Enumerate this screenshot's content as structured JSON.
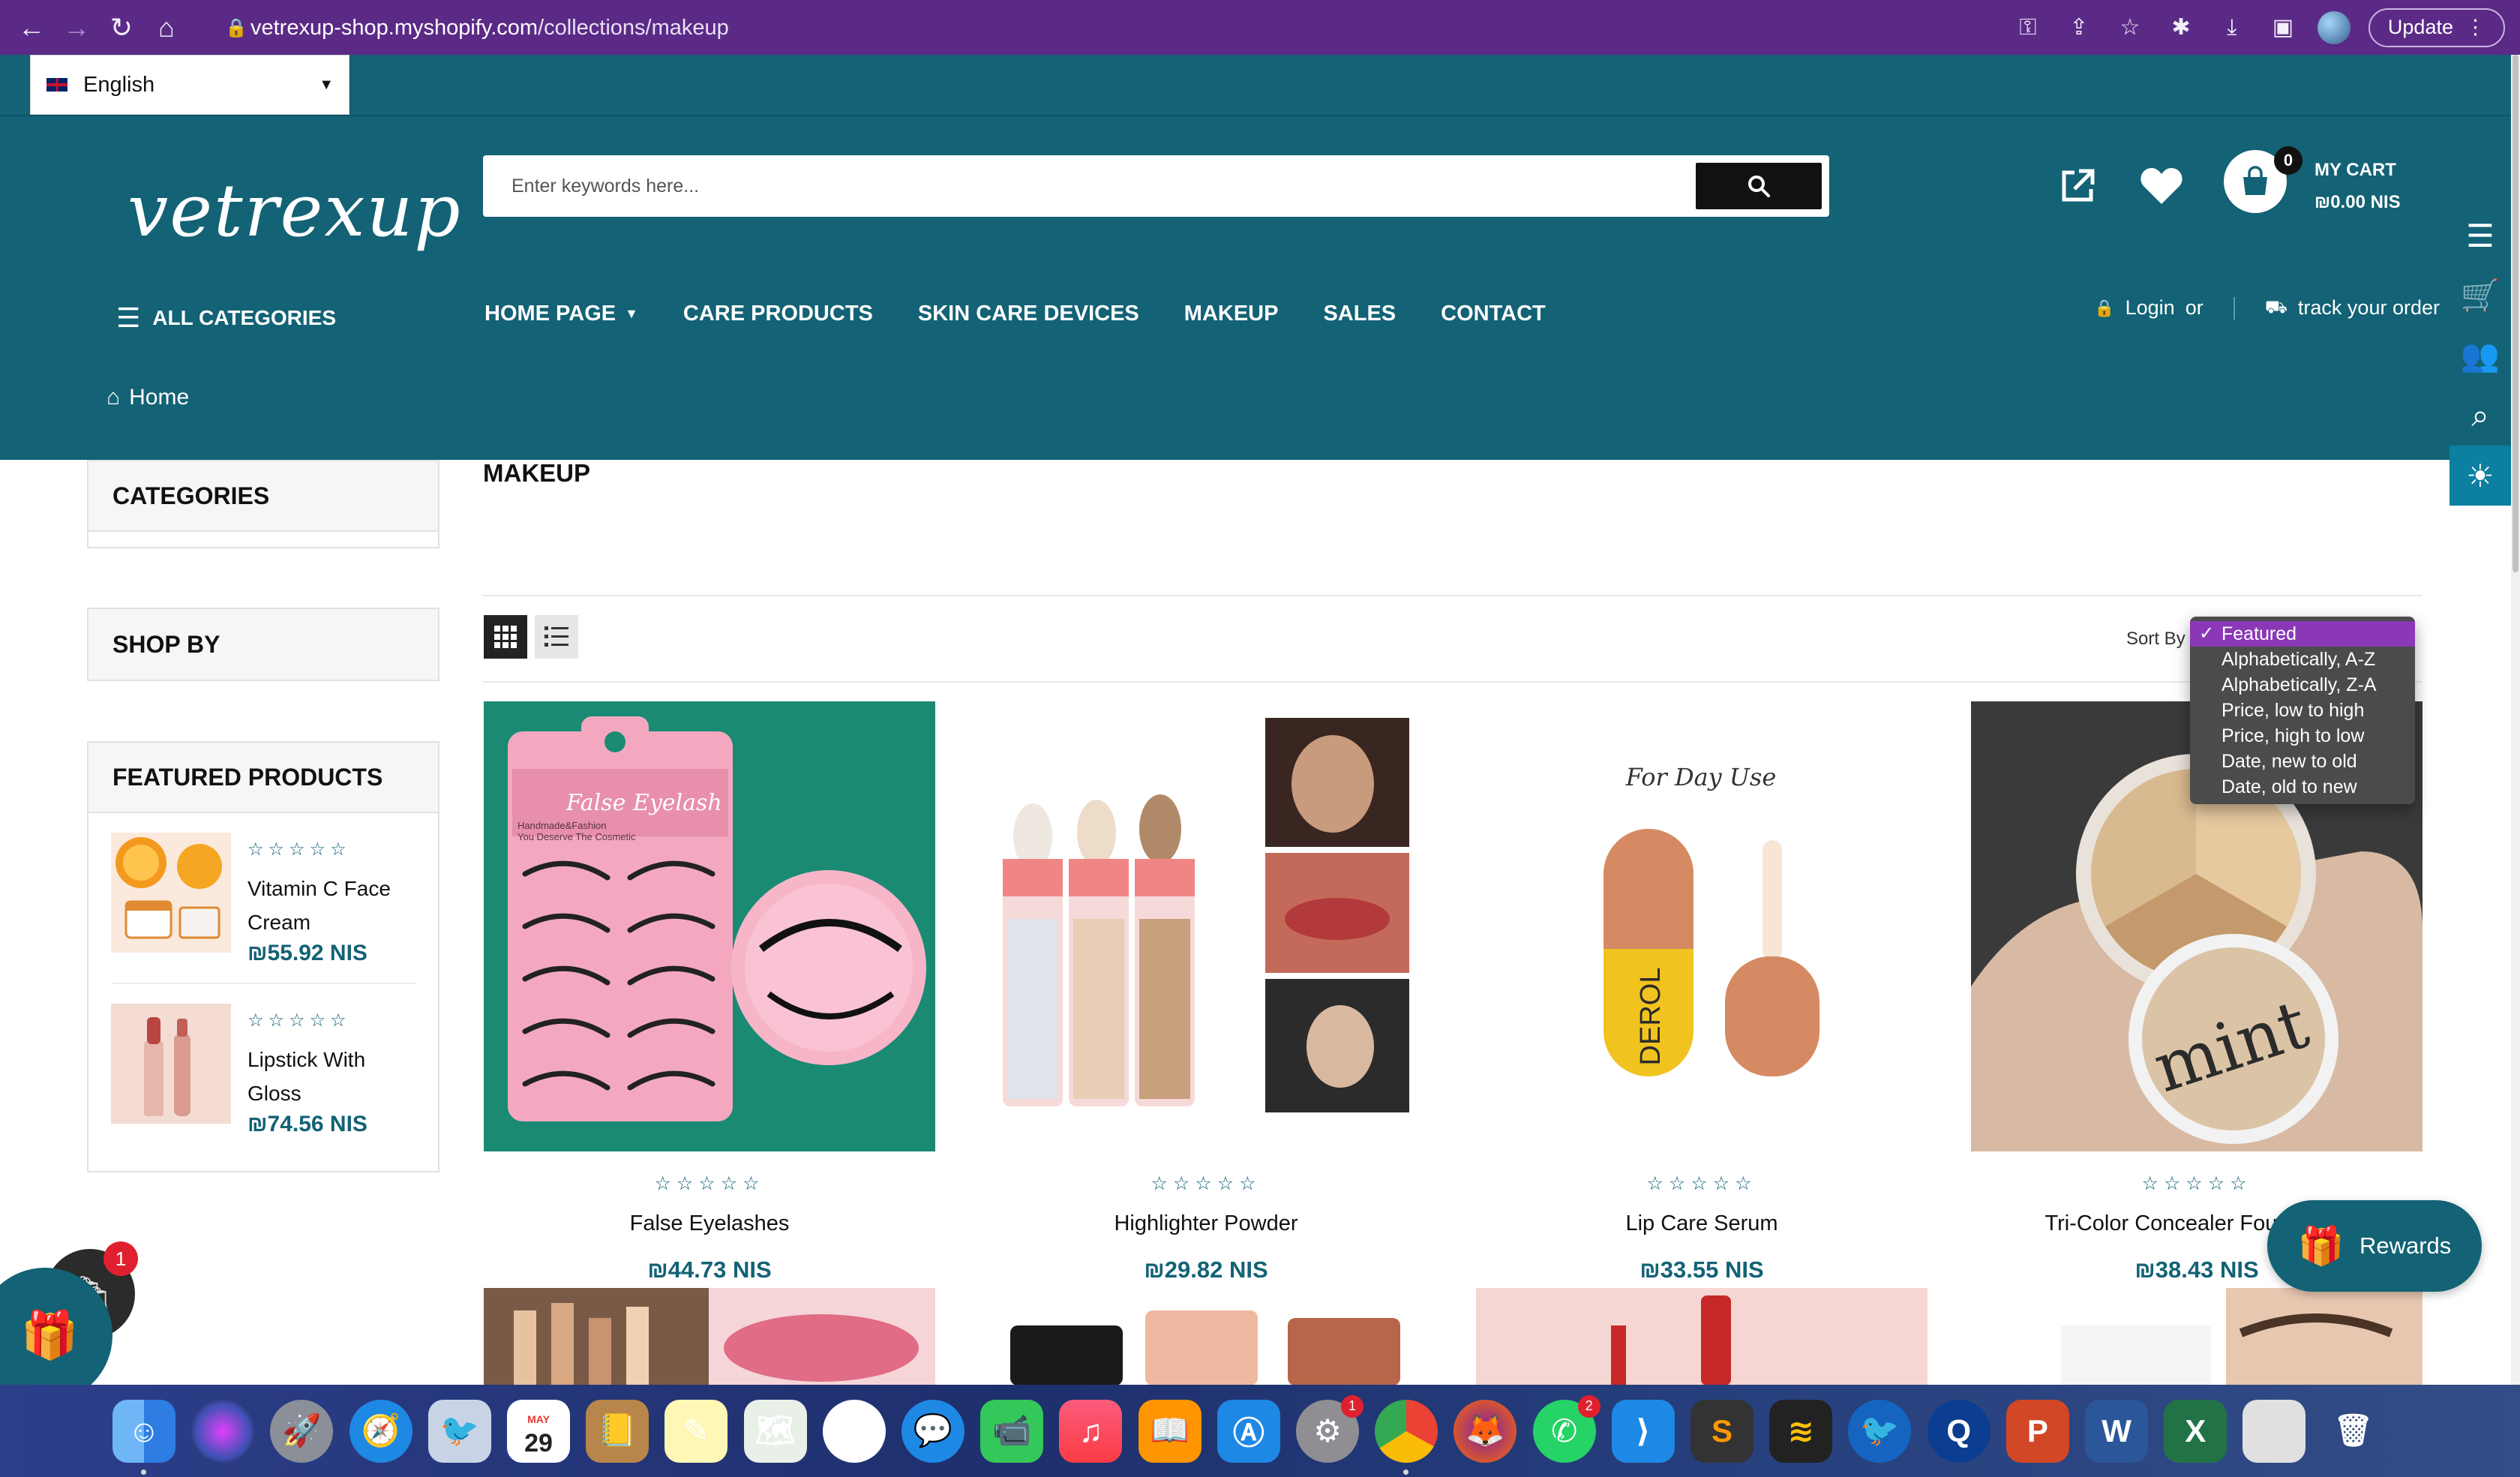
{
  "browser": {
    "url_host": "vetrexup-shop.myshopify.com",
    "url_path": "/collections/makeup",
    "update_label": "Update"
  },
  "header": {
    "language": "English",
    "logo_text": "vetrexup",
    "search_placeholder": "Enter keywords here...",
    "cart_count": "0",
    "cart_title": "MY CART",
    "cart_total": "₪0.00 NIS",
    "all_categories": "ALL CATEGORIES",
    "nav": [
      "HOME PAGE",
      "CARE PRODUCTS",
      "SKIN CARE DEVICES",
      "MAKEUP",
      "SALES",
      "CONTACT"
    ],
    "login": "Login",
    "or": "or",
    "track_order": "track your order",
    "breadcrumb_home": "Home"
  },
  "sidebar": {
    "categories_title": "CATEGORIES",
    "shop_by_title": "SHOP BY",
    "featured_title": "FEATURED PRODUCTS",
    "featured": [
      {
        "name": "Vitamin C Face Cream",
        "price": "₪55.92 NIS",
        "stars": "☆☆☆☆☆"
      },
      {
        "name": "Lipstick With Gloss",
        "price": "₪74.56 NIS",
        "stars": "☆☆☆☆☆"
      }
    ]
  },
  "main": {
    "title": "MAKEUP",
    "sort_label": "Sort By",
    "sort_options": [
      "Featured",
      "Alphabetically, A-Z",
      "Alphabetically, Z-A",
      "Price, low to high",
      "Price, high to low",
      "Date, new to old",
      "Date, old to new"
    ],
    "products": [
      {
        "name": "False Eyelashes",
        "price": "₪44.73 NIS",
        "stars": "☆☆☆☆☆"
      },
      {
        "name": "Highlighter Powder",
        "price": "₪29.82 NIS",
        "stars": "☆☆☆☆☆"
      },
      {
        "name": "Lip Care Serum",
        "price": "₪33.55 NIS",
        "stars": "☆☆☆☆☆"
      },
      {
        "name": "Tri-Color Concealer Foundation",
        "price": "₪38.43 NIS",
        "stars": "☆☆☆☆☆"
      }
    ],
    "lip_serum_tagline": "For Day Use",
    "lip_serum_brand": "DEROL",
    "eyelash_pack_title": "False Eyelash",
    "eyelash_pack_sub1": "Handmade&Fashion",
    "eyelash_pack_sub2": "You Deserve The Cosmetic",
    "concealer_brand": "mint"
  },
  "widgets": {
    "rewards_label": "Rewards",
    "shop_badge": "1"
  },
  "dock": {
    "calendar_month": "MAY",
    "calendar_day": "29",
    "badge_settings": "1",
    "badge_whatsapp": "2"
  },
  "colors": {
    "brand_teal": "#136275",
    "chrome_purple": "#5b2a86",
    "sort_highlight": "#8b38b6"
  }
}
